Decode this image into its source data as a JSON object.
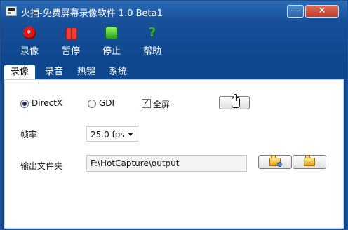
{
  "window": {
    "title": "火捕-免费屏幕录像软件 1.0 Beta1",
    "minimize_glyph": "—",
    "close_glyph": "✕"
  },
  "toolbar": {
    "items": [
      {
        "label": "录像",
        "icon": "record-icon"
      },
      {
        "label": "暂停",
        "icon": "pause-icon"
      },
      {
        "label": "停止",
        "icon": "stop-icon"
      },
      {
        "label": "帮助",
        "icon": "help-icon"
      }
    ]
  },
  "tabs": [
    "录像",
    "录音",
    "热键",
    "系统"
  ],
  "capture": {
    "directx_label": "DirectX",
    "gdi_label": "GDI",
    "fullscreen_label": "全屏",
    "fps_label": "帧率",
    "fps_value": "25.0 fps",
    "output_label": "输出文件夹",
    "output_path": "F:\\HotCapture\\output",
    "help_glyph": "?"
  }
}
